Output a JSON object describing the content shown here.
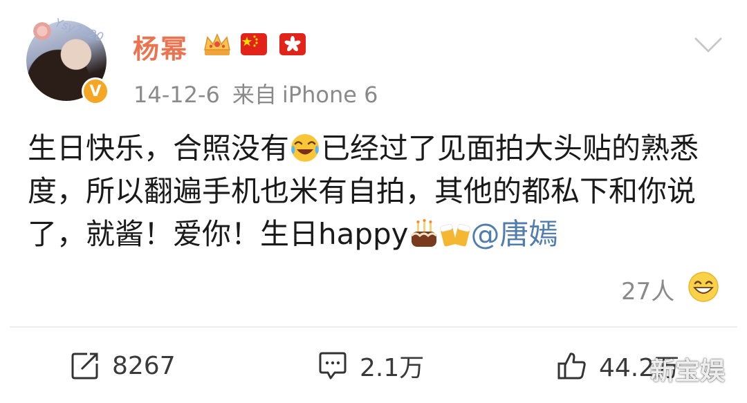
{
  "post": {
    "author": {
      "name": "杨幂",
      "avatar_overlay_text": "Ysy2020",
      "verified_badge_letter": "V"
    },
    "meta": {
      "date": "14-12-6",
      "source_prefix": "来自",
      "device": "iPhone 6"
    },
    "content": {
      "part1": "生日快乐，合照没有",
      "part2": "已经过了见面拍大头贴的熟悉度，所以翻遍手机也米有自拍，其他的都私下和你说了，就酱！爱你！生日happy",
      "mention": "@唐嫣"
    },
    "reaction": {
      "count": "27人",
      "icon": "laugh-emoji-icon"
    },
    "actions": {
      "repost": "8267",
      "comment": "2.1万",
      "like": "44.2万"
    },
    "watermark": "新宝娱"
  },
  "colors": {
    "username": "#eb7350",
    "mention": "#507daf",
    "meta": "#8a8a8a",
    "badge": "#f5a623"
  }
}
